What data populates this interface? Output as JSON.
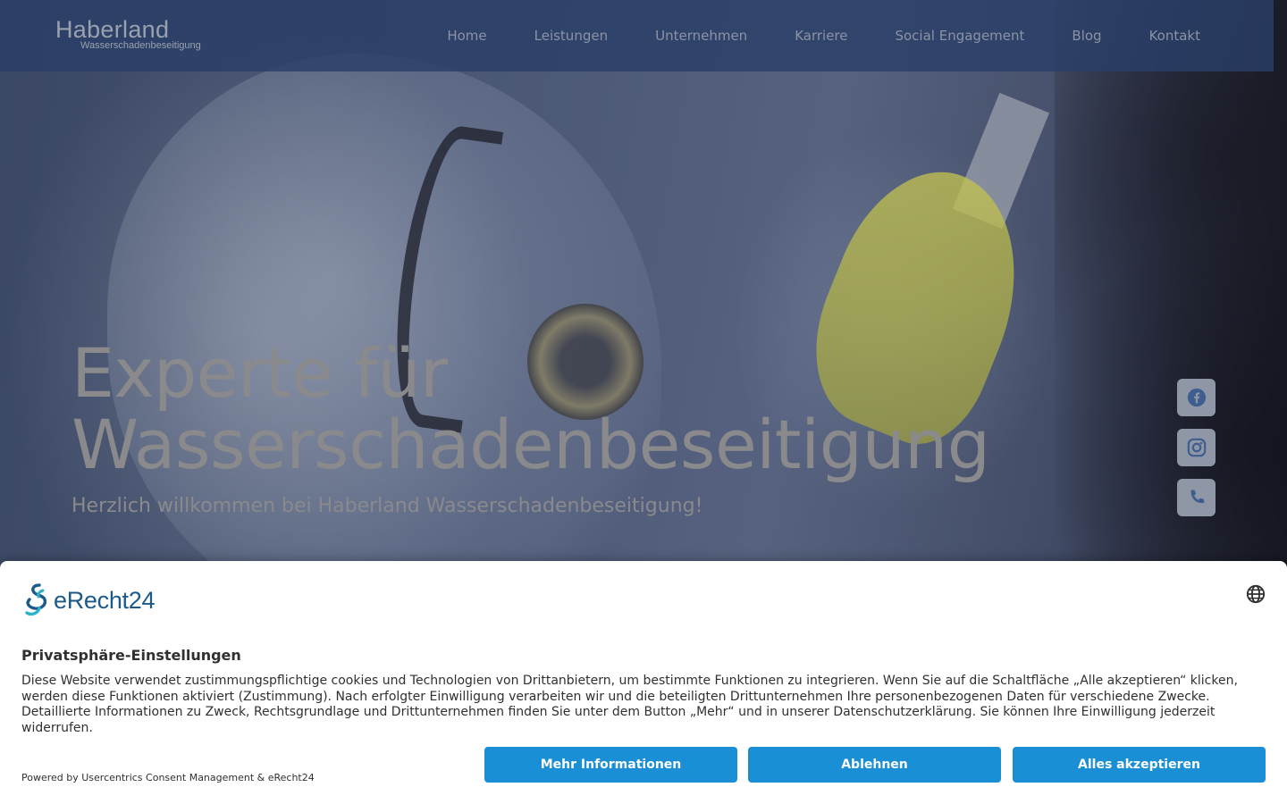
{
  "header": {
    "logo_main": "Haberland",
    "logo_sub": "Wasserschadenbeseitigung",
    "nav": [
      {
        "label": "Home"
      },
      {
        "label": "Leistungen"
      },
      {
        "label": "Unternehmen"
      },
      {
        "label": "Karriere"
      },
      {
        "label": "Social Engagement"
      },
      {
        "label": "Blog"
      },
      {
        "label": "Kontakt"
      }
    ]
  },
  "hero": {
    "title_line1": "Experte für",
    "title_line2": "Wasserschadenbeseitigung",
    "subtitle": "Herzlich willkommen bei Haberland Wasserschadenbeseitigung!"
  },
  "social": [
    {
      "icon": "facebook-icon"
    },
    {
      "icon": "instagram-icon"
    },
    {
      "icon": "phone-icon"
    }
  ],
  "consent": {
    "brand": "eRecht24",
    "title": "Privatsphäre-Einstellungen",
    "text": "Diese Website verwendet zustimmungspflichtige cookies und Technologien von Drittanbietern, um bestimmte Funktionen zu integrieren. Wenn Sie auf die Schaltfläche „Alle akzeptieren“ klicken, werden diese Funktionen aktiviert (Zustimmung). Nach erfolgter Einwilligung verarbeiten wir und die beteiligten Drittunternehmen Ihre personenbezogenen Daten für verschiedene Zwecke. Detaillierte Informationen zu Zweck, Rechtsgrundlage und Drittunternehmen finden Sie unter dem Button „Mehr“ und in unserer Datenschutzerklärung. Sie können Ihre Einwilligung jederzeit widerrufen.",
    "powered_by": "Powered by Usercentrics Consent Management & eRecht24",
    "buttons": {
      "more": "Mehr Informationen",
      "deny": "Ablehnen",
      "accept": "Alles akzeptieren"
    }
  },
  "colors": {
    "header_bg": "#293e68",
    "accent_button": "#1a8fd6",
    "brand_blue": "#1c5a8a"
  }
}
